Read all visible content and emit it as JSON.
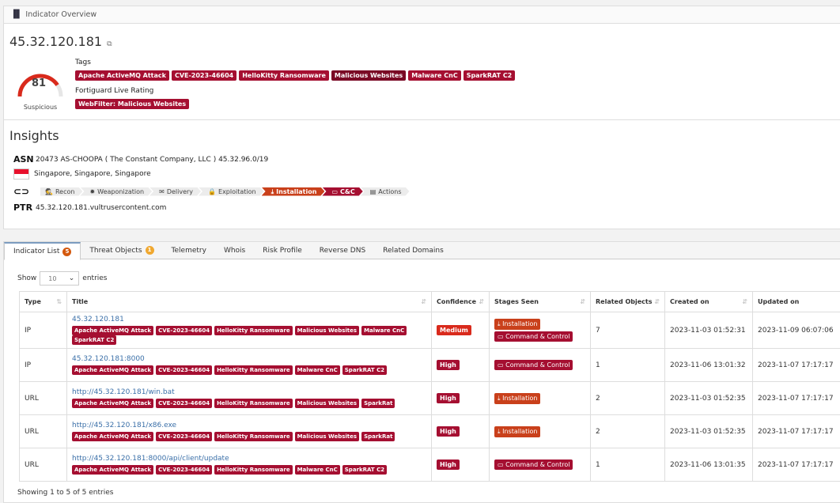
{
  "header": {
    "title": "Indicator Overview",
    "icon": "bar-chart-icon"
  },
  "indicator": {
    "value": "45.32.120.181",
    "score": "81",
    "verdict": "Suspicious",
    "score_fraction": 0.81
  },
  "tags_label": "Tags",
  "tags": [
    {
      "label": "Apache ActiveMQ Attack"
    },
    {
      "label": "CVE-2023-46604"
    },
    {
      "label": "HelloKitty Ransomware"
    },
    {
      "label": "Malicious Websites"
    },
    {
      "label": "Malware CnC"
    },
    {
      "label": "SparkRAT C2"
    }
  ],
  "fortiguard_label": "Fortiguard Live Rating",
  "fortiguard": {
    "label": "WebFilter: Malicious Websites"
  },
  "insights": {
    "title": "Insights",
    "asn_label": "ASN",
    "asn": "20473 AS-CHOOPA ( The Constant Company, LLC ) 45.32.96.0/19",
    "location": "Singapore, Singapore, Singapore",
    "ptr_label": "PTR",
    "ptr": "45.32.120.181.vultrusercontent.com",
    "killchain": [
      "Recon",
      "Weaponization",
      "Delivery",
      "Exploitation",
      "Installation",
      "C&C",
      "Actions"
    ]
  },
  "tabs": [
    {
      "label": "Indicator List",
      "badge": "5"
    },
    {
      "label": "Threat Objects",
      "badge": "1"
    },
    {
      "label": "Telemetry"
    },
    {
      "label": "Whois"
    },
    {
      "label": "Risk Profile"
    },
    {
      "label": "Reverse DNS"
    },
    {
      "label": "Related Domains"
    }
  ],
  "table": {
    "show": "Show",
    "entries": "entries",
    "page_size": "10",
    "columns": [
      "Type",
      "Title",
      "Confidence",
      "Stages Seen",
      "Related Objects",
      "Created on",
      "Updated on"
    ],
    "rows": [
      {
        "type": "IP",
        "title": "45.32.120.181",
        "tags": [
          "Apache ActiveMQ Attack",
          "CVE-2023-46604",
          "HelloKitty Ransomware",
          "Malicious Websites",
          "Malware CnC",
          "SparkRAT C2"
        ],
        "confidence": "Medium",
        "stages": [
          "Installation",
          "Command & Control"
        ],
        "related": "7",
        "created": "2023-11-03 01:52:31",
        "updated": "2023-11-09 06:07:06"
      },
      {
        "type": "IP",
        "title": "45.32.120.181:8000",
        "tags": [
          "Apache ActiveMQ Attack",
          "CVE-2023-46604",
          "HelloKitty Ransomware",
          "Malware CnC",
          "SparkRAT C2"
        ],
        "confidence": "High",
        "stages": [
          "Command & Control"
        ],
        "related": "1",
        "created": "2023-11-06 13:01:32",
        "updated": "2023-11-07 17:17:17"
      },
      {
        "type": "URL",
        "title": "http://45.32.120.181/win.bat",
        "tags": [
          "Apache ActiveMQ Attack",
          "CVE-2023-46604",
          "HelloKitty Ransomware",
          "Malicious Websites",
          "SparkRat"
        ],
        "confidence": "High",
        "stages": [
          "Installation"
        ],
        "related": "2",
        "created": "2023-11-03 01:52:35",
        "updated": "2023-11-07 17:17:17"
      },
      {
        "type": "URL",
        "title": "http://45.32.120.181/x86.exe",
        "tags": [
          "Apache ActiveMQ Attack",
          "CVE-2023-46604",
          "HelloKitty Ransomware",
          "Malicious Websites",
          "SparkRat"
        ],
        "confidence": "High",
        "stages": [
          "Installation"
        ],
        "related": "2",
        "created": "2023-11-03 01:52:35",
        "updated": "2023-11-07 17:17:17"
      },
      {
        "type": "URL",
        "title": "http://45.32.120.181:8000/api/client/update",
        "tags": [
          "Apache ActiveMQ Attack",
          "CVE-2023-46604",
          "HelloKitty Ransomware",
          "Malware CnC",
          "SparkRAT C2"
        ],
        "confidence": "High",
        "stages": [
          "Command & Control"
        ],
        "related": "1",
        "created": "2023-11-06 13:01:35",
        "updated": "2023-11-07 17:17:17"
      }
    ],
    "footer": "Showing 1 to 5 of 5 entries"
  },
  "colors": {
    "tag": "#a50f31",
    "medium": "#d92a1c",
    "high": "#a50f31",
    "installation": "#c9401b",
    "cc": "#a50f31",
    "tab_badge_1": "#d4590e",
    "tab_badge_2": "#f0a830"
  }
}
